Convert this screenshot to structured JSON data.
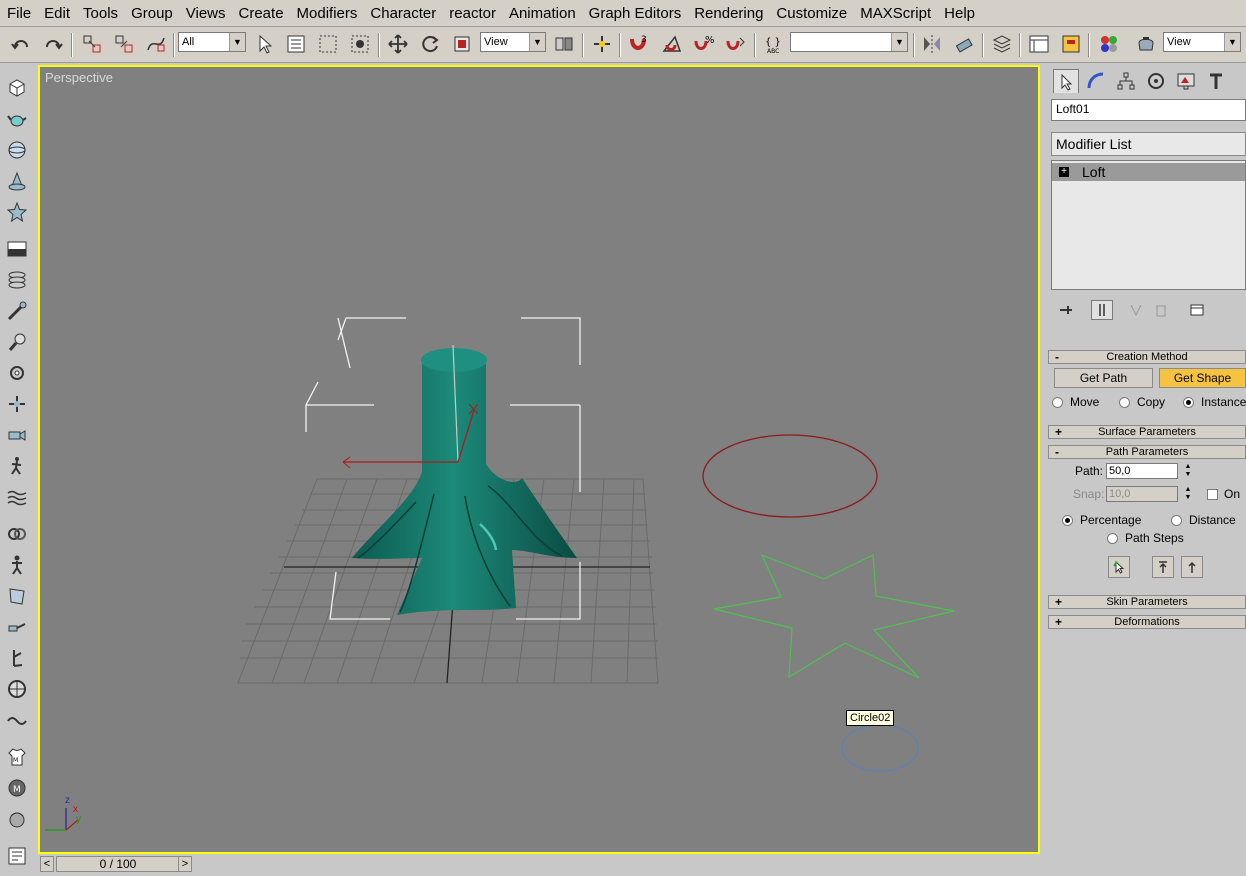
{
  "menu": [
    "File",
    "Edit",
    "Tools",
    "Group",
    "Views",
    "Create",
    "Modifiers",
    "Character",
    "reactor",
    "Animation",
    "Graph Editors",
    "Rendering",
    "Customize",
    "MAXScript",
    "Help"
  ],
  "toolbar": {
    "selection_filter": "All",
    "ref_coord": "View",
    "named_selection": "",
    "render_combo": "View"
  },
  "viewport": {
    "label": "Perspective",
    "tooltip": "Circle02",
    "axis_z": "z",
    "axis_y": "y",
    "axis_x": "x"
  },
  "timeline": {
    "frame": "0 / 100",
    "prev": "<",
    "next": ">"
  },
  "panel": {
    "object_name": "Loft01",
    "modifier_list": "Modifier List",
    "stack_item": "Loft",
    "creation_method": {
      "title": "Creation Method",
      "get_path": "Get Path",
      "get_shape": "Get Shape",
      "move": "Move",
      "copy": "Copy",
      "instance": "Instance",
      "selected": "Instance"
    },
    "surface_parameters": "Surface Parameters",
    "path_parameters": {
      "title": "Path Parameters",
      "path_label": "Path:",
      "path_value": "50,0",
      "snap_label": "Snap:",
      "snap_value": "10,0",
      "on_label": "On",
      "percentage": "Percentage",
      "distance": "Distance",
      "path_steps": "Path Steps",
      "selected": "Percentage"
    },
    "skin_parameters": "Skin Parameters",
    "deformations": "Deformations"
  },
  "colors": {
    "viewport_bg": "#808080",
    "active_border": "#ffff00",
    "loft_mesh": "#127567",
    "circle01": "#8b1a1a",
    "star": "#4ec24e",
    "circle02": "#5b82b8",
    "highlight_button": "#f5c242"
  }
}
